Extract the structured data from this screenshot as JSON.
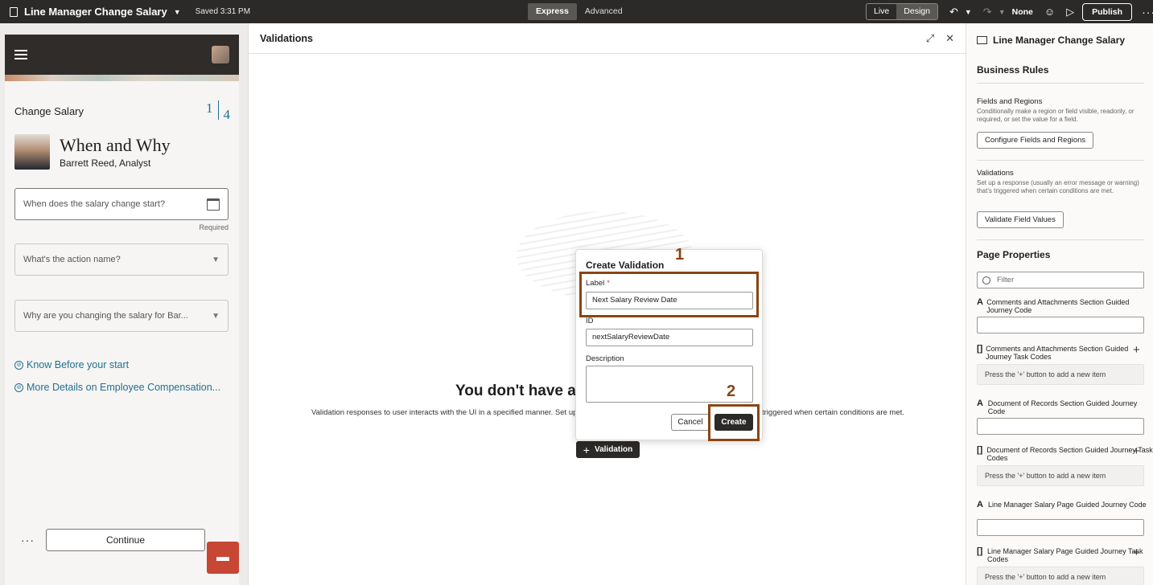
{
  "topbar": {
    "app_title": "Line Manager Change Salary",
    "saved": "Saved 3:31 PM",
    "mode_express": "Express",
    "mode_advanced": "Advanced",
    "live": "Live",
    "design": "Design",
    "sandbox": "None",
    "publish": "Publish"
  },
  "preview": {
    "page_title": "Change Salary",
    "step_current": "1",
    "step_total": "4",
    "heading": "When and Why",
    "person": "Barrett Reed, Analyst",
    "date_placeholder": "When does the salary change start?",
    "required": "Required",
    "action_placeholder": "What's the action name?",
    "reason_placeholder": "Why are you changing the salary for Bar...",
    "link_know": "Know Before your start",
    "link_details": "More Details on Employee Compensation...",
    "continue": "Continue"
  },
  "validations": {
    "title": "Validations",
    "empty_title": "You don't have ar",
    "empty_desc_left": "Validation responses to user interacts with the UI in a specified manner. Set up a",
    "empty_desc_right": "triggered when certain conditions are met.",
    "add_button": "Validation"
  },
  "dialog": {
    "title": "Create Validation",
    "label_label": "Label",
    "label_required": "*",
    "label_value": "Next Salary Review Date",
    "id_label": "ID",
    "id_value": "nextSalaryReviewDate",
    "description_label": "Description",
    "cancel": "Cancel",
    "create": "Create"
  },
  "annotations": {
    "step1": "1",
    "step2": "2"
  },
  "properties": {
    "title": "Line Manager Change Salary",
    "business_rules": "Business Rules",
    "fields_regions_title": "Fields and Regions",
    "fields_regions_desc": "Conditionally make a region or field visible, readonly, or required, or set the value for a field.",
    "configure_button": "Configure Fields and Regions",
    "validations_title": "Validations",
    "validations_desc": "Set up a response (usually an error message or warning) that's triggered when certain conditions are met.",
    "validate_button": "Validate Field Values",
    "page_properties": "Page Properties",
    "filter_placeholder": "Filter",
    "items": [
      {
        "label": "Comments and Attachments Section Guided Journey Code",
        "type": "text"
      },
      {
        "label": "Comments and Attachments Section Guided Journey Task Codes",
        "type": "array",
        "empty": "Press the '+' button to add a new item"
      },
      {
        "label": "Document of Records Section Guided Journey Code",
        "type": "text"
      },
      {
        "label": "Document of Records Section Guided Journey Task Codes",
        "type": "array",
        "empty": "Press the '+' button to add a new item"
      },
      {
        "label": "Line Manager Salary Page Guided Journey Code",
        "type": "text"
      },
      {
        "label": "Line Manager Salary Page Guided Journey Task Codes",
        "type": "array",
        "empty": "Press the '+' button to add a new item"
      }
    ]
  },
  "colors": {
    "topbar": "#2b2a28",
    "accent_link": "#227093",
    "annotation": "#8b4513",
    "chat": "#c74634"
  }
}
